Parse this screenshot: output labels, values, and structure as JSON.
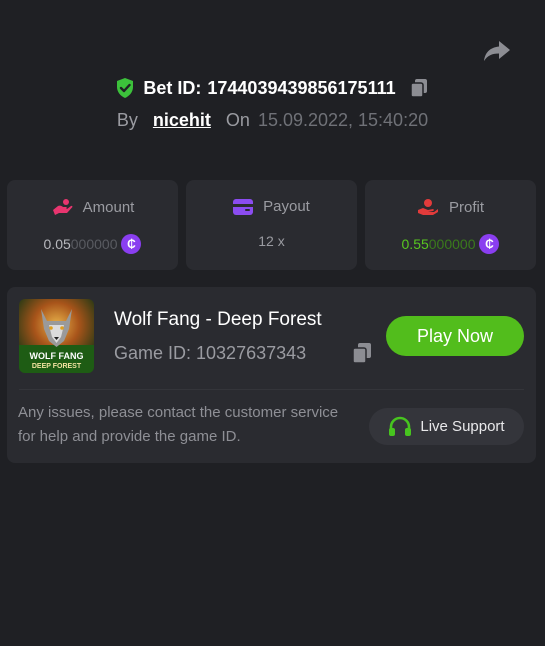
{
  "header": {
    "bet_label": "Bet ID:",
    "bet_id": "1744039439856175111",
    "by_label": "By",
    "username": "nicehit",
    "on_label": "On",
    "datetime": "15.09.2022, 15:40:20"
  },
  "stats": {
    "amount": {
      "label": "Amount",
      "value_main": "0.05",
      "value_dim": "000000",
      "icon": "amount-icon"
    },
    "payout": {
      "label": "Payout",
      "value": "12 x",
      "icon": "wallet-icon"
    },
    "profit": {
      "label": "Profit",
      "value_main": "0.55",
      "value_dim": "000000",
      "icon": "profit-icon"
    },
    "coin_symbol": "₵"
  },
  "game": {
    "title": "Wolf Fang - Deep Forest",
    "id_text": "Game ID: 10327637343",
    "thumb_text_1": "WOLF FANG",
    "thumb_text_2": "DEEP FOREST",
    "play_label": "Play Now"
  },
  "support": {
    "notice": "Any issues, please contact the customer service for help and provide the game ID.",
    "button_label": "Live Support"
  },
  "colors": {
    "background": "#1f2024",
    "card": "#2a2b30",
    "accent_green": "#52bd1c",
    "coin_purple": "#8a3ef0",
    "amount_pink": "#e8356f",
    "payout_purple": "#8b4cf0",
    "profit_red": "#e23b3b"
  }
}
